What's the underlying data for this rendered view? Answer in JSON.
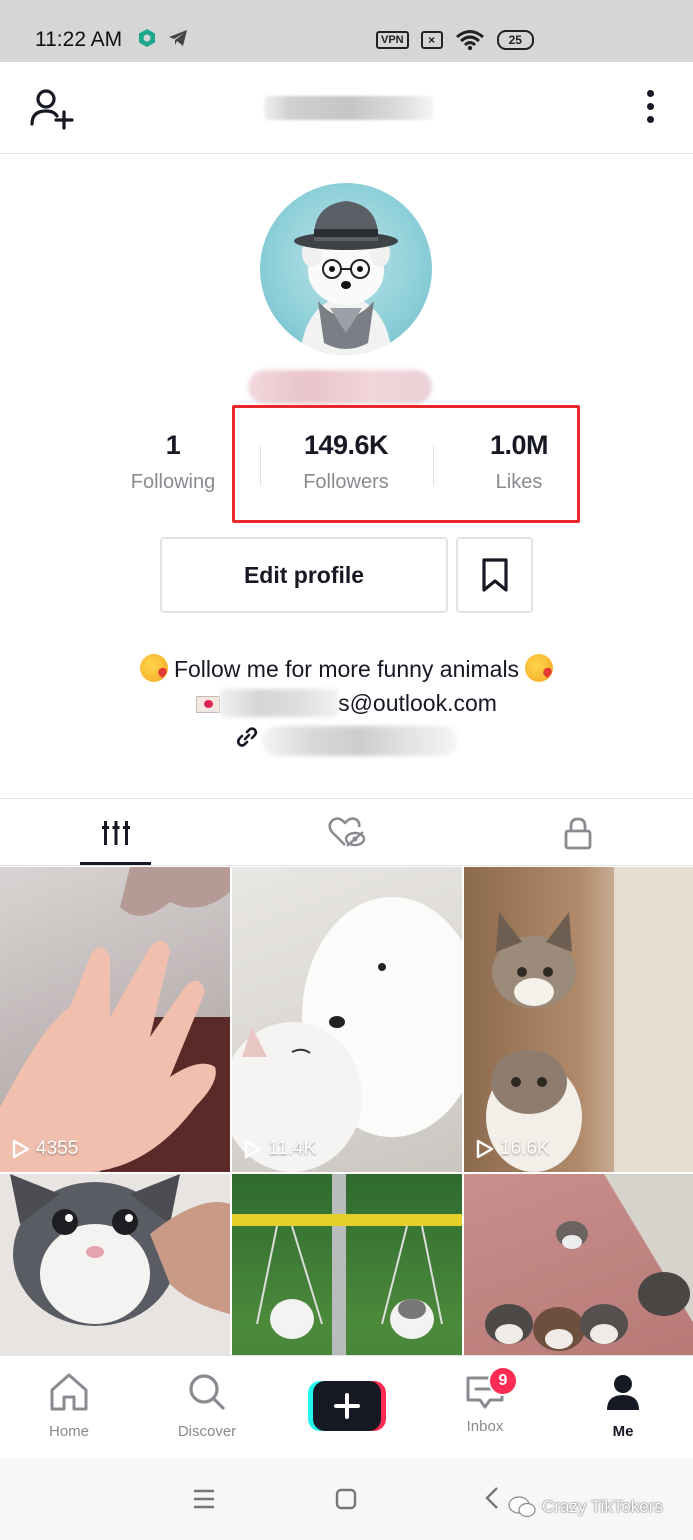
{
  "status_bar": {
    "time": "11:22 AM",
    "vpn_label": "VPN",
    "battery_level": "25"
  },
  "header": {
    "add_user_icon": "person-plus-icon",
    "more_icon": "vertical-dots-icon"
  },
  "profile": {
    "avatar_icon": "avatar-dog-in-hat"
  },
  "stats": [
    {
      "value": "1",
      "label": "Following"
    },
    {
      "value": "149.6K",
      "label": "Followers"
    },
    {
      "value": "1.0M",
      "label": "Likes"
    }
  ],
  "actions": {
    "edit_profile_label": "Edit profile",
    "bookmark_icon": "bookmark-icon"
  },
  "bio": {
    "line1": "Follow me for more funny animals",
    "email_suffix": "s@outlook.com",
    "link_suffix": "'B*U"
  },
  "tabs": [
    {
      "icon": "grid-bars-icon",
      "active": true
    },
    {
      "icon": "liked-hidden-icon",
      "active": false
    },
    {
      "icon": "lock-icon",
      "active": false
    }
  ],
  "videos": [
    {
      "views": "4355"
    },
    {
      "views": "11.4K"
    },
    {
      "views": "16.6K"
    },
    {
      "views": ""
    },
    {
      "views": ""
    },
    {
      "views": ""
    }
  ],
  "bottom_nav": {
    "home": "Home",
    "discover": "Discover",
    "inbox": "Inbox",
    "inbox_badge": "9",
    "me": "Me"
  },
  "watermark": "Crazy TikTokers",
  "colors": {
    "highlight_box": "#e8282b",
    "badge": "#fe2c55",
    "text_primary": "#161823",
    "text_secondary": "#8a8b91"
  }
}
